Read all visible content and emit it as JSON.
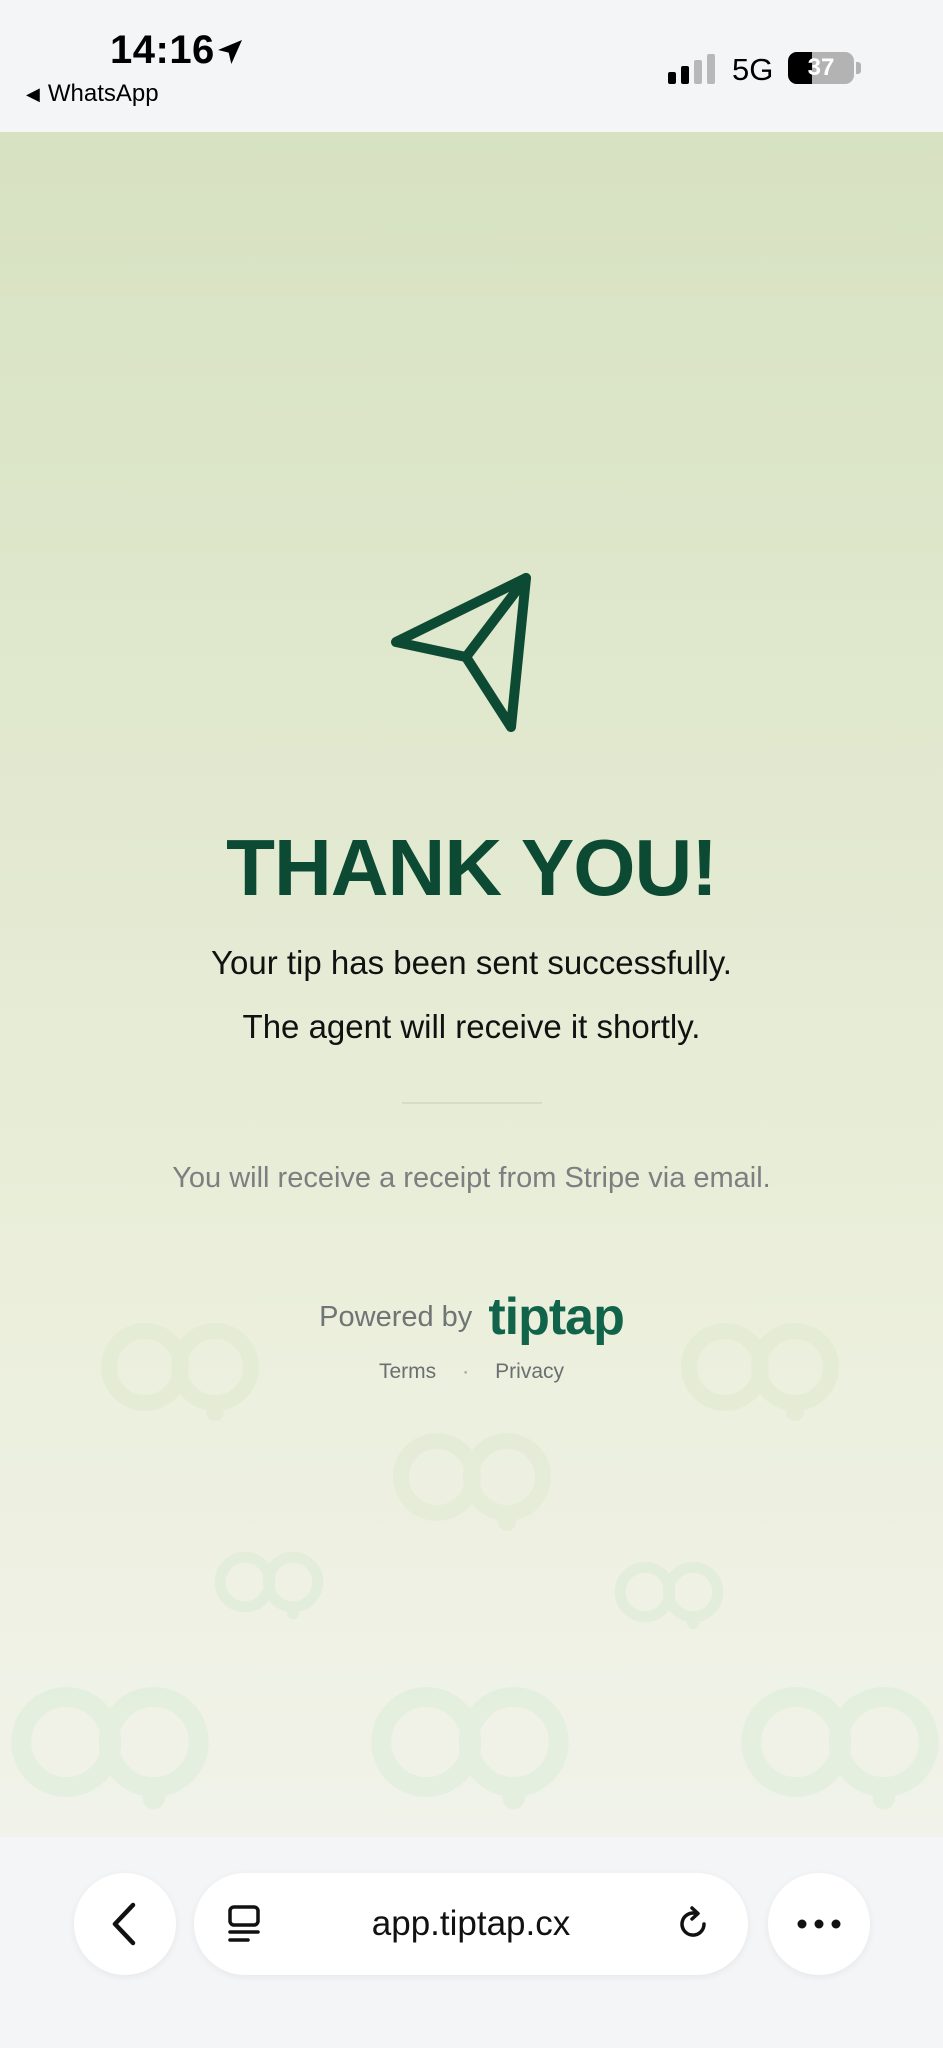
{
  "status_bar": {
    "time": "14:16",
    "back_app": "WhatsApp",
    "network": "5G",
    "battery": "37",
    "battery_level": 0.37,
    "icons": [
      "location-arrow-icon",
      "signal-icon",
      "battery-icon"
    ]
  },
  "page": {
    "title": "THANK YOU!",
    "message_line1": "Your tip has been sent successfully.",
    "message_line2": "The agent will receive it shortly.",
    "receipt_note": "You will receive a receipt from Stripe via email.",
    "powered_by": "Powered by",
    "brand": "tiptap",
    "links": {
      "terms": "Terms",
      "separator": "·",
      "privacy": "Privacy"
    },
    "icon": "paper-plane-icon",
    "colors": {
      "accent": "#0c4a33",
      "brand": "#11644a",
      "background_top": "#d7e2c2",
      "background_bottom": "#f1f3ea"
    }
  },
  "browser_toolbar": {
    "url": "app.tiptap.cx",
    "icons": [
      "back-chevron-icon",
      "tabs-icon",
      "reload-icon",
      "more-icon"
    ]
  }
}
